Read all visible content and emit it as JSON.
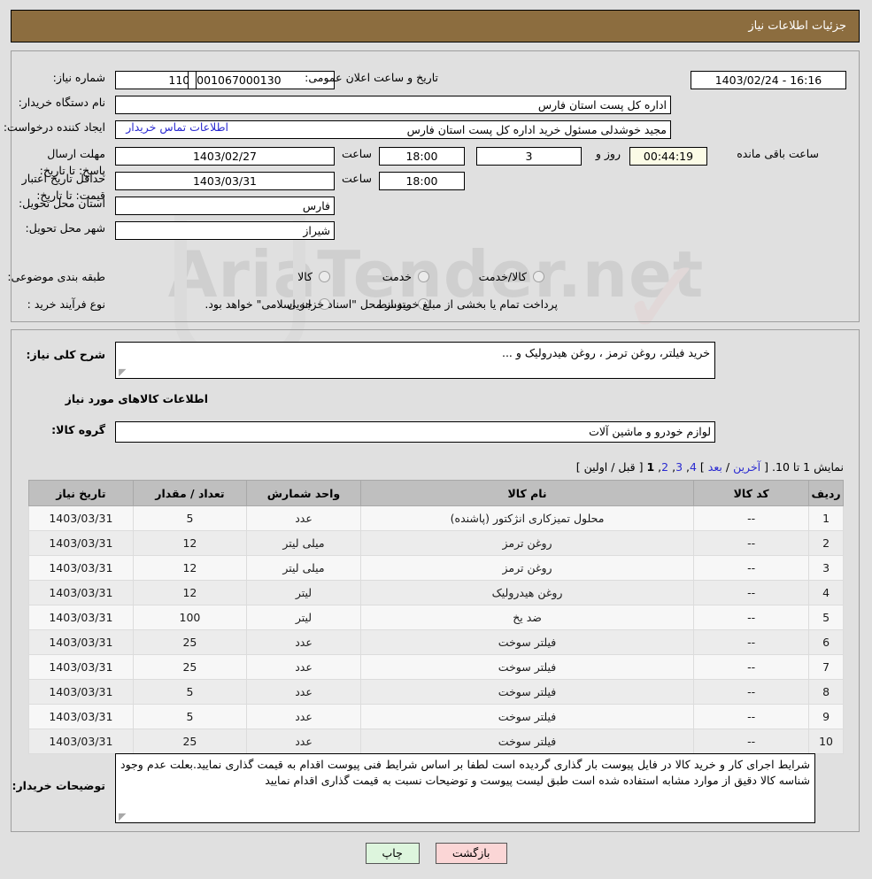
{
  "header": {
    "title": "جزئیات اطلاعات نیاز"
  },
  "form": {
    "need_number_label": "شماره نیاز:",
    "need_number_value": "1103001067000130",
    "announce_label": "تاریخ و ساعت اعلان عمومی:",
    "announce_value": "16:16 - 1403/02/24",
    "buyer_org_label": "نام دستگاه خریدار:",
    "buyer_org_value": "اداره کل پست استان فارس",
    "requester_label": "ایجاد کننده درخواست:",
    "requester_value": "مجید خوشدلی مسئول خرید اداره کل پست استان فارس",
    "contact_link": "اطلاعات تماس خریدار",
    "deadline_label": "مهلت ارسال پاسخ: تا تاریخ:",
    "deadline_date": "1403/02/27",
    "hour_label": "ساعت",
    "deadline_hour": "18:00",
    "days_value": "3",
    "days_unit": "روز و",
    "countdown_value": "00:44:19",
    "countdown_suffix": "ساعت باقی مانده",
    "validity_label": "حداقل تاریخ اعتبار قیمت: تا تاریخ:",
    "validity_date": "1403/03/31",
    "validity_hour": "18:00",
    "province_label": "استان محل تحویل:",
    "province_value": "فارس",
    "city_label": "شهر محل تحویل:",
    "city_value": "شیراز",
    "category_label": "طبقه بندی موضوعی:",
    "category_options": [
      "کالا",
      "خدمت",
      "کالا/خدمت"
    ],
    "process_label": "نوع فرآیند خرید :",
    "process_options": [
      "جزیی",
      "متوسط"
    ],
    "process_note": "پرداخت تمام یا بخشی از مبلغ خرید،از محل \"اسناد خزانه اسلامی\" خواهد بود."
  },
  "description": {
    "label": "شرح کلی نیاز:",
    "value": "خرید فیلتر، روغن ترمز ، روغن هیدرولیک و ..."
  },
  "goods_section": {
    "heading": "اطلاعات کالاهای مورد نیاز",
    "group_label": "گروه کالا:",
    "group_value": "لوازم خودرو و ماشین آلات"
  },
  "pagination": {
    "prefix": "نمایش 1 تا 10.",
    "open_bracket": "[",
    "last_link": "آخرین",
    "sep1": "/",
    "next_link": "بعد",
    "close_bracket1": "]",
    "pages": [
      "4",
      "3",
      "2",
      "1"
    ],
    "current_page": "1",
    "open_bracket2": "[",
    "prev_link": "قبل",
    "sep2": "/",
    "first_link": "اولین",
    "close_bracket2": "]"
  },
  "table": {
    "columns": [
      "ردیف",
      "کد کالا",
      "نام کالا",
      "واحد شمارش",
      "تعداد / مقدار",
      "تاریخ نیاز"
    ],
    "rows": [
      {
        "row": "1",
        "code": "--",
        "name": "محلول تمیزکاری انژکتور (پاشنده)",
        "unit": "عدد",
        "qty": "5",
        "date": "1403/03/31"
      },
      {
        "row": "2",
        "code": "--",
        "name": "روغن ترمز",
        "unit": "میلی لیتر",
        "qty": "12",
        "date": "1403/03/31"
      },
      {
        "row": "3",
        "code": "--",
        "name": "روغن ترمز",
        "unit": "میلی لیتر",
        "qty": "12",
        "date": "1403/03/31"
      },
      {
        "row": "4",
        "code": "--",
        "name": "روغن هیدرولیک",
        "unit": "لیتر",
        "qty": "12",
        "date": "1403/03/31"
      },
      {
        "row": "5",
        "code": "--",
        "name": "ضد یخ",
        "unit": "لیتر",
        "qty": "100",
        "date": "1403/03/31"
      },
      {
        "row": "6",
        "code": "--",
        "name": "فیلتر سوخت",
        "unit": "عدد",
        "qty": "25",
        "date": "1403/03/31"
      },
      {
        "row": "7",
        "code": "--",
        "name": "فیلتر سوخت",
        "unit": "عدد",
        "qty": "25",
        "date": "1403/03/31"
      },
      {
        "row": "8",
        "code": "--",
        "name": "فیلتر سوخت",
        "unit": "عدد",
        "qty": "5",
        "date": "1403/03/31"
      },
      {
        "row": "9",
        "code": "--",
        "name": "فیلتر سوخت",
        "unit": "عدد",
        "qty": "5",
        "date": "1403/03/31"
      },
      {
        "row": "10",
        "code": "--",
        "name": "فیلتر سوخت",
        "unit": "عدد",
        "qty": "25",
        "date": "1403/03/31"
      }
    ]
  },
  "buyer_notes": {
    "label": "توضیحات خریدار:",
    "value": "شرایط اجرای کار و خرید کالا در فایل پیوست بار گذاری گردیده است لطفا بر اساس شرایط فنی پیوست اقدام به قیمت گذاری نمایید.بعلت عدم وجود شناسه کالا دقیق از موارد مشابه استفاده شده است طبق لیست پیوست و توضیحات نسبت به قیمت گذاری اقدام نمایید"
  },
  "buttons": {
    "print": "چاپ",
    "back": "بازگشت"
  },
  "watermark": {
    "text": "AriaTender.net"
  },
  "colors": {
    "header_bg": "#8c6d3f",
    "page_bg": "#e0e0e0",
    "link": "#2a2ad0",
    "table_header_bg": "#bfbfbf",
    "print_btn": "#ddf5dd",
    "back_btn": "#fbd6d6",
    "countdown_bg": "#fbfbe6"
  }
}
